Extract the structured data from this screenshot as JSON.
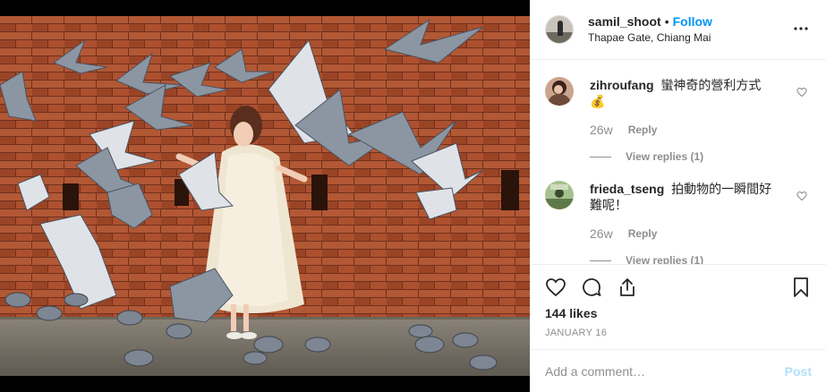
{
  "post": {
    "photo_icon": "photo-of-woman-with-pigeons",
    "username": "samil_shoot",
    "separator": "•",
    "follow_label": "Follow",
    "location": "Thapae Gate, Chiang Mai",
    "more_icon": "more-horizontal-icon"
  },
  "comments": [
    {
      "user": "zihroufang",
      "text": "蠻神奇的營利方式💰",
      "time": "26w",
      "reply_label": "Reply",
      "view_replies": "View replies (1)"
    },
    {
      "user": "frieda_tseng",
      "text": "拍動物的一瞬間好難呢！",
      "time": "26w",
      "reply_label": "Reply",
      "view_replies": "View replies (1)"
    }
  ],
  "actions": {
    "icons": [
      "heart-icon",
      "comment-icon",
      "share-icon",
      "bookmark-icon"
    ],
    "likes": "144 likes",
    "date": "JANUARY 16"
  },
  "add_comment": {
    "placeholder": "Add a comment…",
    "post_label": "Post"
  },
  "colors": {
    "accent": "#0095f6",
    "post_disabled": "#b2dffc",
    "muted": "#8e8e8e",
    "text": "#262626",
    "brick": "#b5512e"
  }
}
